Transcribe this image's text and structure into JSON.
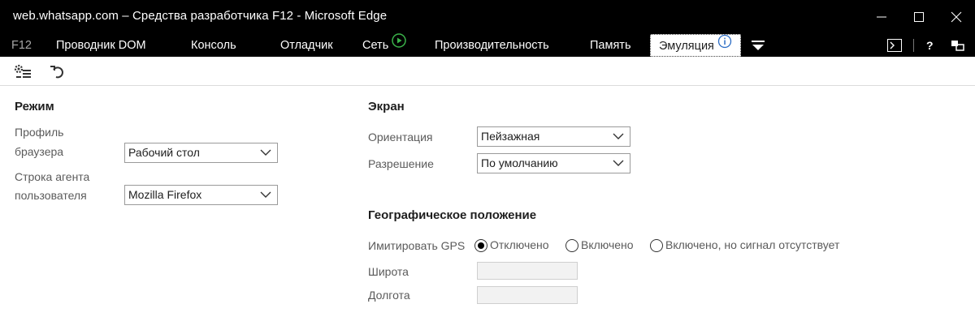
{
  "window": {
    "title": "web.whatsapp.com – Средства разработчика F12 - Microsoft Edge"
  },
  "tabs": {
    "f12": "F12",
    "dom": "Проводник DOM",
    "console": "Консоль",
    "debugger": "Отладчик",
    "network": "Сеть",
    "performance": "Производительность",
    "memory": "Память",
    "emulation": "Эмуляция"
  },
  "mode": {
    "title": "Режим",
    "browser_profile_label_1": "Профиль",
    "browser_profile_label_2": "браузера",
    "browser_profile_value": "Рабочий стол",
    "user_agent_label_1": "Строка агента",
    "user_agent_label_2": "пользователя",
    "user_agent_value": "Mozilla Firefox"
  },
  "screen": {
    "title": "Экран",
    "orientation_label": "Ориентация",
    "orientation_value": "Пейзажная",
    "resolution_label": "Разрешение",
    "resolution_value": "По умолчанию"
  },
  "geo": {
    "title": "Географическое положение",
    "gps_label": "Имитировать GPS",
    "options": [
      "Отключено",
      "Включено",
      "Включено, но сигнал отсутствует"
    ],
    "selected_option": "Отключено",
    "latitude_label": "Широта",
    "longitude_label": "Долгота",
    "latitude_value": "",
    "longitude_value": ""
  }
}
